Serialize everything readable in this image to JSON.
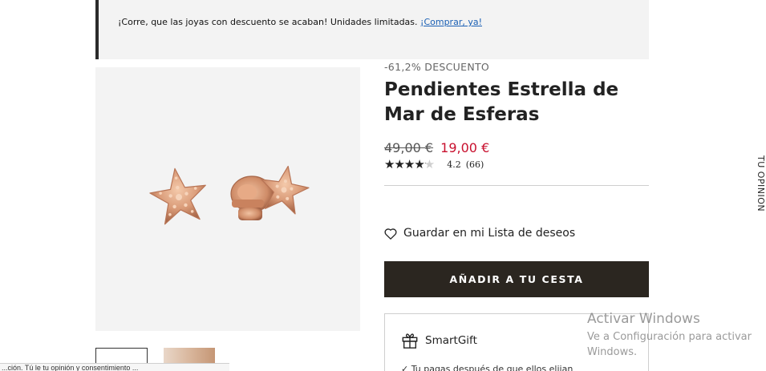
{
  "banner": {
    "text": "¡Corre, que las joyas con descuento se acaban! Unidades limitadas.",
    "link": "¡Comprar, ya!"
  },
  "product": {
    "discount": "-61,2% DESCUENTO",
    "title": "Pendientes Estrella de Mar de Esferas",
    "old_price": "49,00 €",
    "new_price": "19,00 €",
    "rating": {
      "stars": "★★★★★",
      "score": 4.2,
      "value": "4.2",
      "count": "(66)"
    },
    "image_icon": "starfish-earrings-image"
  },
  "actions": {
    "wishlist": "Guardar en mi Lista de deseos",
    "add_to_cart": "AÑADIR A TU CESTA"
  },
  "smartgift": {
    "title": "SmartGift",
    "feature": "✓ Tu pagas después de que ellos elijan"
  },
  "side_tab": "TU OPINION",
  "cookie_bar": "...ción. Tú le tu opinión y consentimiento ...",
  "watermark": {
    "title": "Activar Windows",
    "subtitle": "Ve a Configuración para activar Windows."
  },
  "colors": {
    "sale_price": "#c8102e",
    "button_bg": "#2b2620",
    "banner_bg": "#f3f3f3",
    "link": "#1a5fb4"
  }
}
